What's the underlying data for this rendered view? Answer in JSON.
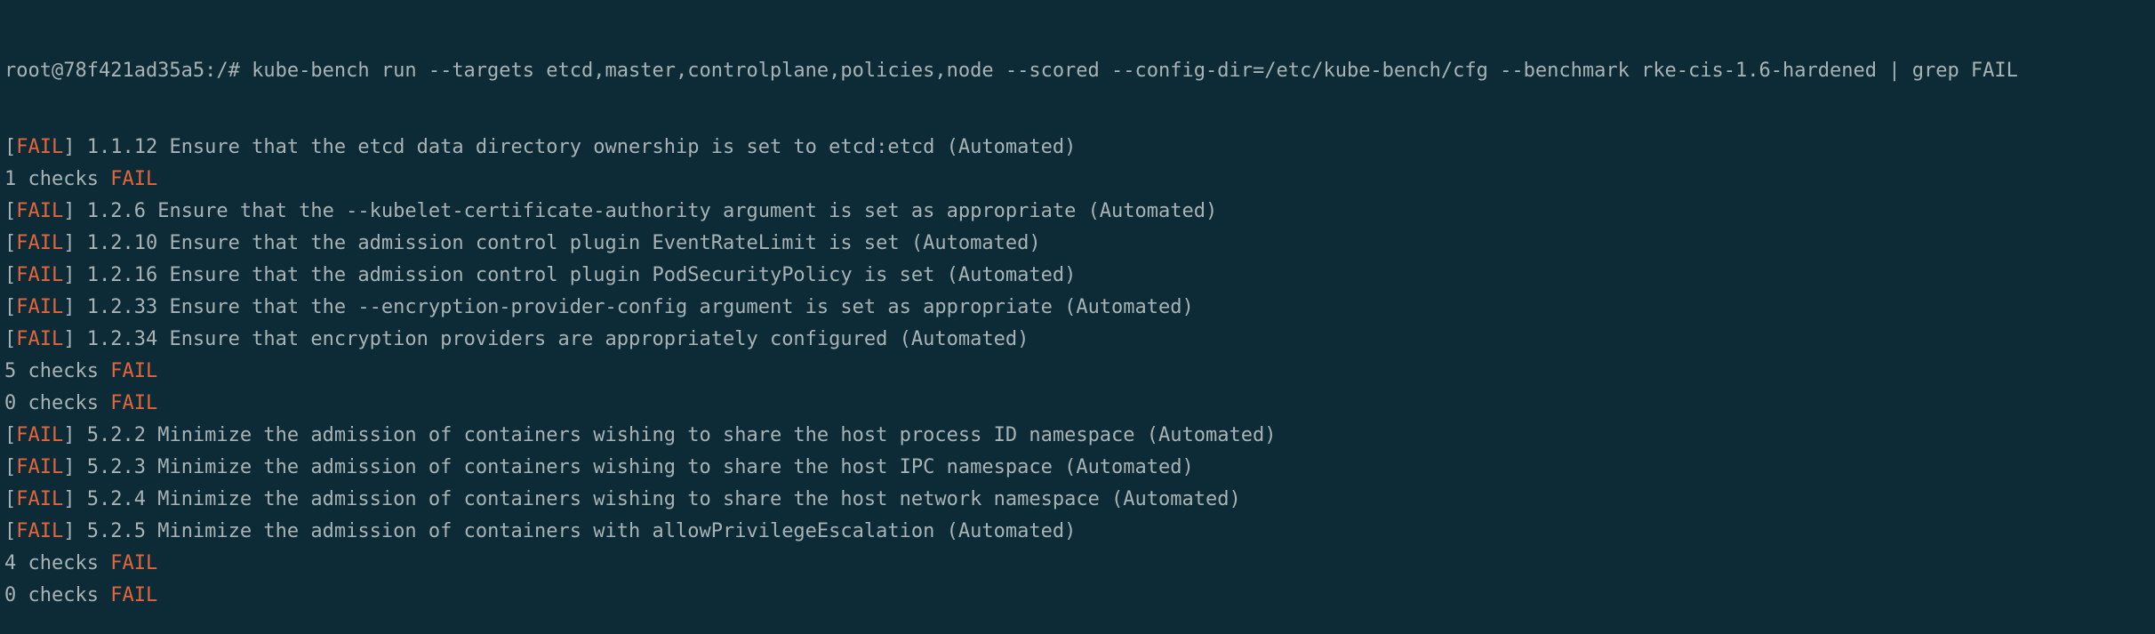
{
  "terminal": {
    "command_line": "root@78f421ad35a5:/# kube-bench run --targets etcd,master,controlplane,policies,node --scored --config-dir=/etc/kube-bench/cfg --benchmark rke-cis-1.6-hardened | grep FAIL",
    "fail_tag": "FAIL",
    "fail_word": "FAIL",
    "lines": [
      {
        "kind": "result",
        "text": " 1.1.12 Ensure that the etcd data directory ownership is set to etcd:etcd (Automated)"
      },
      {
        "kind": "summary",
        "text": "1 checks "
      },
      {
        "kind": "result",
        "text": " 1.2.6 Ensure that the --kubelet-certificate-authority argument is set as appropriate (Automated)"
      },
      {
        "kind": "result",
        "text": " 1.2.10 Ensure that the admission control plugin EventRateLimit is set (Automated)"
      },
      {
        "kind": "result",
        "text": " 1.2.16 Ensure that the admission control plugin PodSecurityPolicy is set (Automated)"
      },
      {
        "kind": "result",
        "text": " 1.2.33 Ensure that the --encryption-provider-config argument is set as appropriate (Automated)"
      },
      {
        "kind": "result",
        "text": " 1.2.34 Ensure that encryption providers are appropriately configured (Automated)"
      },
      {
        "kind": "summary",
        "text": "5 checks "
      },
      {
        "kind": "summary",
        "text": "0 checks "
      },
      {
        "kind": "result",
        "text": " 5.2.2 Minimize the admission of containers wishing to share the host process ID namespace (Automated)"
      },
      {
        "kind": "result",
        "text": " 5.2.3 Minimize the admission of containers wishing to share the host IPC namespace (Automated)"
      },
      {
        "kind": "result",
        "text": " 5.2.4 Minimize the admission of containers wishing to share the host network namespace (Automated)"
      },
      {
        "kind": "result",
        "text": " 5.2.5 Minimize the admission of containers with allowPrivilegeEscalation (Automated)"
      },
      {
        "kind": "summary",
        "text": "4 checks "
      },
      {
        "kind": "summary",
        "text": "0 checks "
      }
    ]
  },
  "colors": {
    "background": "#0d2b36",
    "text": "#a7b3b5",
    "fail": "#e4653b"
  }
}
